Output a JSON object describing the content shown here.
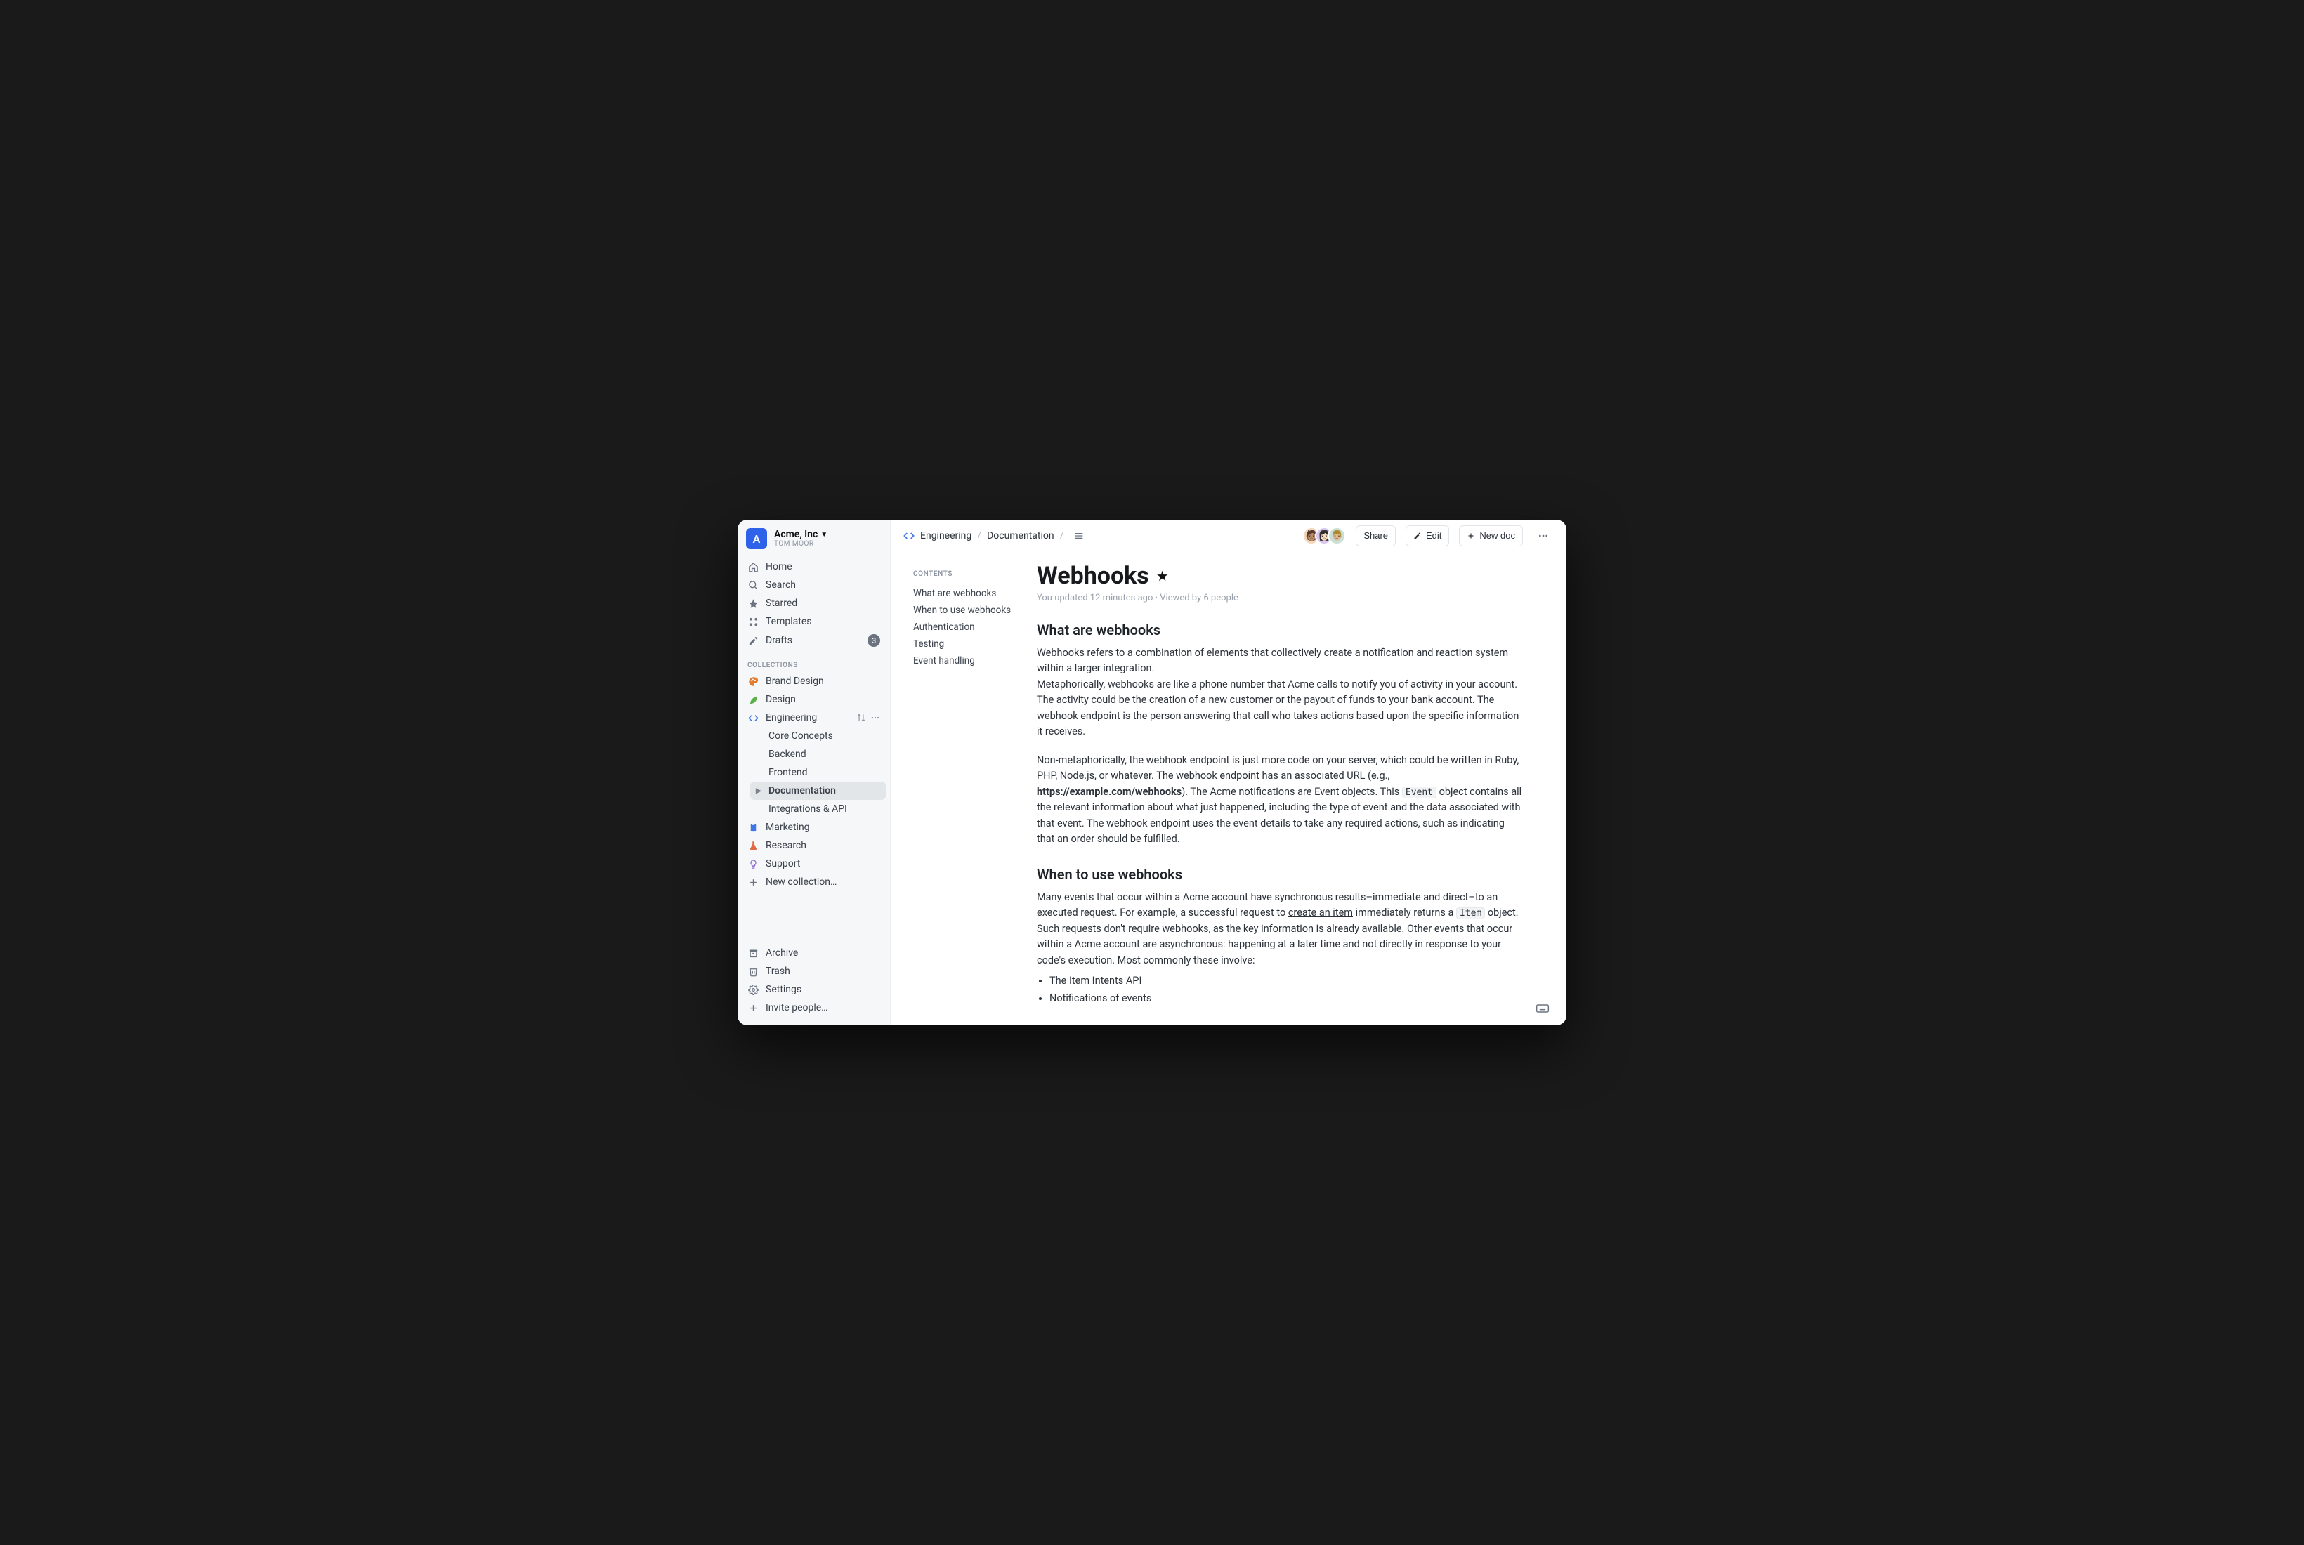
{
  "workspace": {
    "badge_letter": "A",
    "name": "Acme, Inc",
    "user": "TOM MOOR"
  },
  "nav": {
    "home": "Home",
    "search": "Search",
    "starred": "Starred",
    "templates": "Templates",
    "drafts": "Drafts",
    "drafts_count": "3"
  },
  "collections_label": "COLLECTIONS",
  "collections": {
    "brand_design": "Brand Design",
    "design": "Design",
    "engineering": "Engineering",
    "engineering_children": {
      "core_concepts": "Core Concepts",
      "backend": "Backend",
      "frontend": "Frontend",
      "documentation": "Documentation",
      "integrations": "Integrations & API"
    },
    "marketing": "Marketing",
    "research": "Research",
    "support": "Support",
    "new_collection": "New collection…"
  },
  "bottom": {
    "archive": "Archive",
    "trash": "Trash",
    "settings": "Settings",
    "invite": "Invite people…"
  },
  "breadcrumbs": {
    "a": "Engineering",
    "b": "Documentation"
  },
  "topbar": {
    "share": "Share",
    "edit": "Edit",
    "new_doc": "New doc"
  },
  "toc": {
    "title": "CONTENTS",
    "items": [
      "What are webhooks",
      "When to use webhooks",
      "Authentication",
      "Testing",
      "Event handling"
    ]
  },
  "doc": {
    "title": "Webhooks",
    "meta": "You updated 12 minutes ago · Viewed by 6 people",
    "h_what": "What are webhooks",
    "p1": "Webhooks refers to a combination of elements that collectively create a notification and reaction system within a larger integration.",
    "p2": "Metaphorically, webhooks are like a phone number that Acme calls to notify you of activity in your account. The activity could be the creation of a new customer or the payout of funds to your bank account. The webhook endpoint is the person answering that call who takes actions based upon the specific information it receives.",
    "p3a": "Non-metaphorically, the webhook endpoint is just more code on your server, which could be written in Ruby, PHP, Node.js, or whatever. The webhook endpoint has an associated URL (e.g., ",
    "p3_url": "https://example.com/webhooks",
    "p3b": "). The Acme notifications are ",
    "p3_link_event": "Event",
    "p3c": " objects. This ",
    "p3_code_event": "Event",
    "p3d": " object contains all the relevant information about what just happened, including the type of event and the data associated with that event. The webhook endpoint uses the event details to take any required actions, such as indicating that an order should be fulfilled.",
    "h_when": "When to use webhooks",
    "p4a": "Many events that occur within a Acme account have synchronous results–immediate and direct–to an executed request. For example, a successful request to ",
    "p4_link": "create an item",
    "p4b": " immediately returns a ",
    "p4_code": "Item",
    "p4c": " object. Such requests don't require webhooks, as the key information is already available. Other events that occur within a Acme account are asynchronous: happening at a later time and not directly in response to your code's execution. Most commonly these involve:",
    "li1a": "The ",
    "li1_link": "Item Intents API",
    "li2": "Notifications of events"
  }
}
